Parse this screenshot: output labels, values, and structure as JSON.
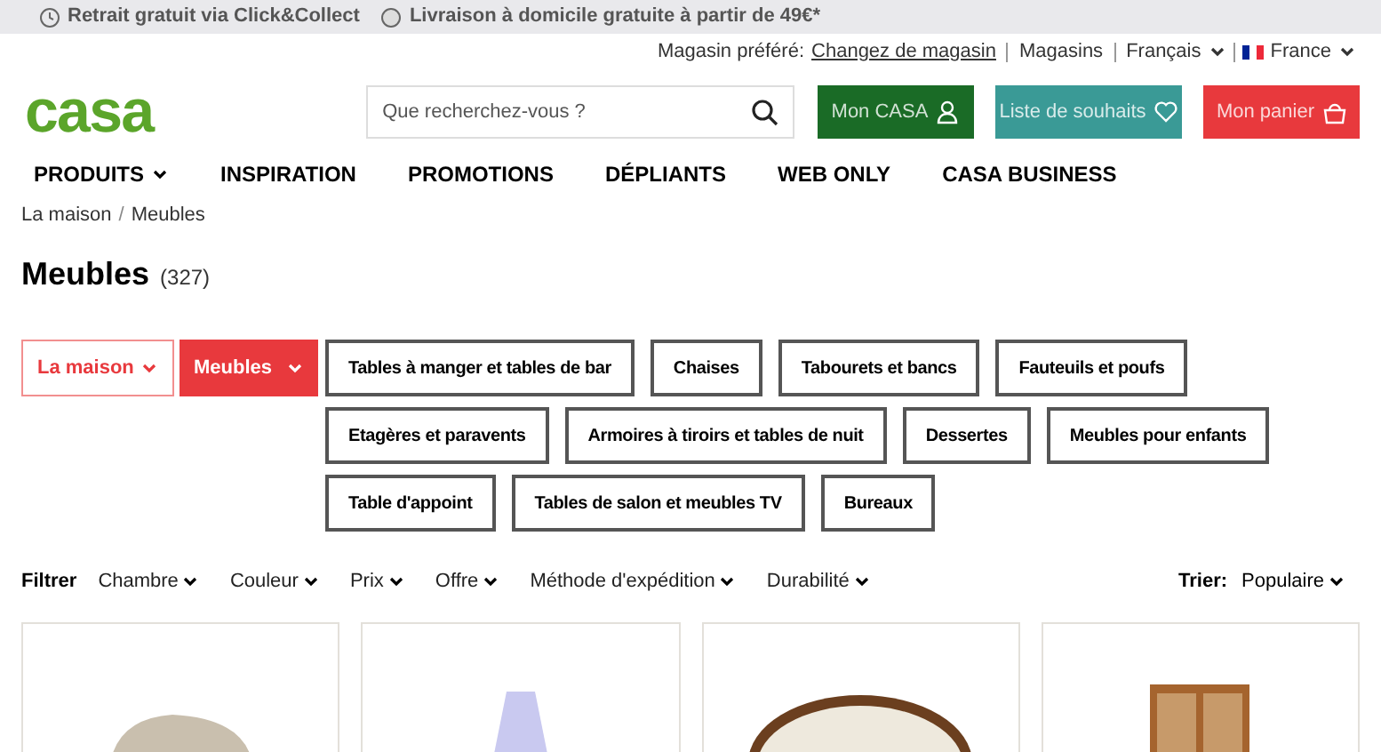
{
  "promo_bar": [
    {
      "kind": "clock",
      "text": "Retrait gratuit via Click&Collect"
    },
    {
      "kind": "truck",
      "text": "Livraison à domicile gratuite à partir de 49€*"
    }
  ],
  "utility": {
    "store_label": "Magasin préféré:",
    "store_link": "Changez de magasin",
    "stores": "Magasins",
    "language": "Français",
    "country": "France"
  },
  "logo": "casa",
  "search": {
    "placeholder": "Que recherchez-vous ?"
  },
  "header_buttons": [
    {
      "kind": "account",
      "label": "Mon CASA",
      "color": "#1a6b26"
    },
    {
      "kind": "wishlist",
      "label": "Liste de souhaits",
      "color": "#3a9a96"
    },
    {
      "kind": "cart",
      "label": "Mon panier",
      "color": "#e8393d"
    }
  ],
  "nav": [
    {
      "label": "PRODUITS",
      "dropdown": true
    },
    {
      "label": "INSPIRATION",
      "dropdown": false
    },
    {
      "label": "PROMOTIONS",
      "dropdown": false
    },
    {
      "label": "DÉPLIANTS",
      "dropdown": false
    },
    {
      "label": "WEB ONLY",
      "dropdown": false
    },
    {
      "label": "CASA BUSINESS",
      "dropdown": false
    }
  ],
  "breadcrumb": [
    "La maison",
    "Meubles"
  ],
  "breadcrumb_separator": "/",
  "title": "Meubles",
  "count": "(327)",
  "category_path": [
    {
      "label": "La maison",
      "selected": false
    },
    {
      "label": "Meubles",
      "selected": true
    }
  ],
  "subcategories": [
    "Tables à manger et tables de bar",
    "Chaises",
    "Tabourets et bancs",
    "Fauteuils et poufs",
    "Etagères et paravents",
    "Armoires à tiroirs et tables de nuit",
    "Dessertes",
    "Meubles pour enfants",
    "Table d'appoint",
    "Tables de salon et meubles TV",
    "Bureaux"
  ],
  "filters": {
    "label": "Filtrer",
    "options": [
      "Chambre",
      "Couleur",
      "Prix",
      "Offre",
      "Méthode d'expédition",
      "Durabilité"
    ]
  },
  "sort": {
    "label": "Trier:",
    "value": "Populaire"
  },
  "products": [
    {
      "kind": "pouf"
    },
    {
      "kind": "lamp"
    },
    {
      "kind": "papasan"
    },
    {
      "kind": "cabinet"
    }
  ]
}
